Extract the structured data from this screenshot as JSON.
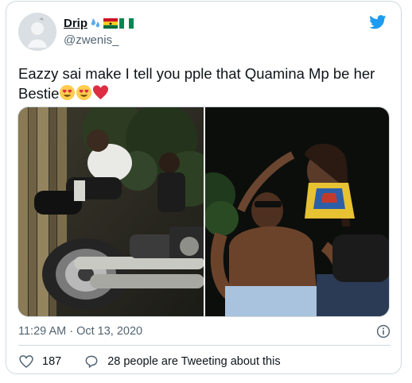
{
  "user": {
    "name": "Drip",
    "handle": "@zwenis_",
    "name_emoji_icons": [
      "droplets-icon",
      "ghana-flag-icon",
      "nigeria-flag-icon"
    ]
  },
  "tweet": {
    "text": "Eazzy sai make I tell you pple that Quamina Mp be her Bestie",
    "trailing_emoji_icons": [
      "heart-eyes-emoji",
      "heart-eyes-emoji",
      "red-heart-emoji"
    ]
  },
  "meta": {
    "timestamp": "11:29 AM · Oct 13, 2020"
  },
  "actions": {
    "likes": "187",
    "conversation_label": "28 people are Tweeting about this"
  },
  "colors": {
    "brand": "#1d9bf0",
    "text": "#0f1419",
    "secondary": "#536471",
    "border": "#cfd9de",
    "heart": "#e0245e"
  },
  "icons": [
    "twitter-bird-icon",
    "info-icon",
    "heart-icon",
    "conversation-icon"
  ]
}
